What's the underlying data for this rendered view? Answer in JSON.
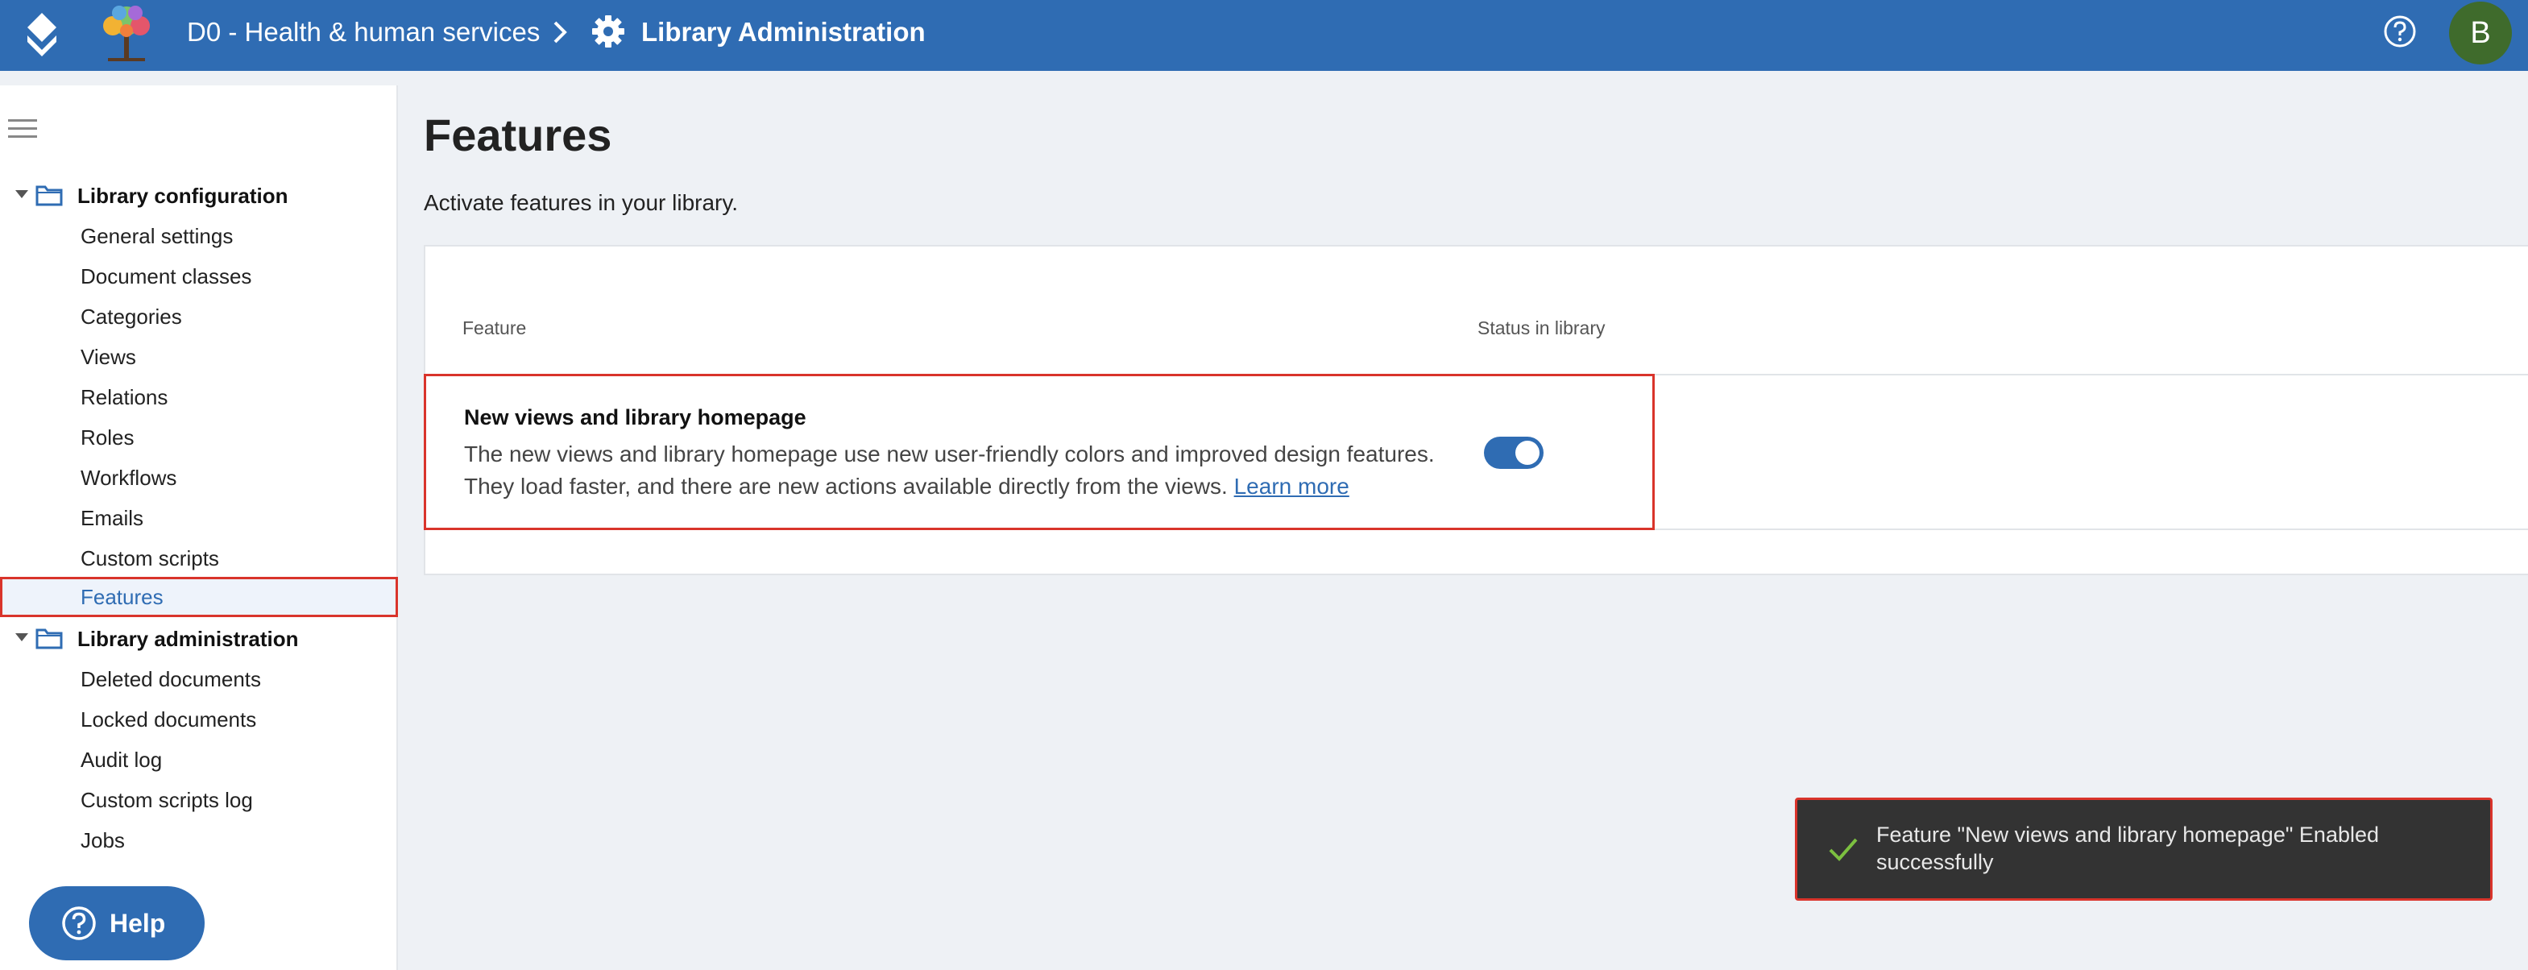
{
  "header": {
    "library_name": "D0 - Health & human services",
    "section_title": "Library Administration",
    "avatar_initial": "B",
    "brand_color": "#2f6cb3"
  },
  "sidebar": {
    "groups": [
      {
        "label": "Library configuration",
        "items": [
          "General settings",
          "Document classes",
          "Categories",
          "Views",
          "Relations",
          "Roles",
          "Workflows",
          "Emails",
          "Custom scripts",
          "Features"
        ]
      },
      {
        "label": "Library administration",
        "items": [
          "Deleted documents",
          "Locked documents",
          "Audit log",
          "Custom scripts log",
          "Jobs"
        ]
      }
    ],
    "active_item": "Features",
    "help_label": "Help"
  },
  "main": {
    "title": "Features",
    "subtitle": "Activate features in your library.",
    "table": {
      "col_feature": "Feature",
      "col_status": "Status in library",
      "rows": [
        {
          "name": "New views and library homepage",
          "description_line1": "The new views and library homepage use new user-friendly colors and improved design features.",
          "description_line2": "They load faster, and there are new actions available directly from the views.",
          "link_text": "Learn more",
          "enabled": true
        }
      ]
    }
  },
  "toast": {
    "message_line1": "Feature \"New views and library homepage\" Enabled",
    "message_line2": "successfully",
    "icon": "check-icon"
  }
}
